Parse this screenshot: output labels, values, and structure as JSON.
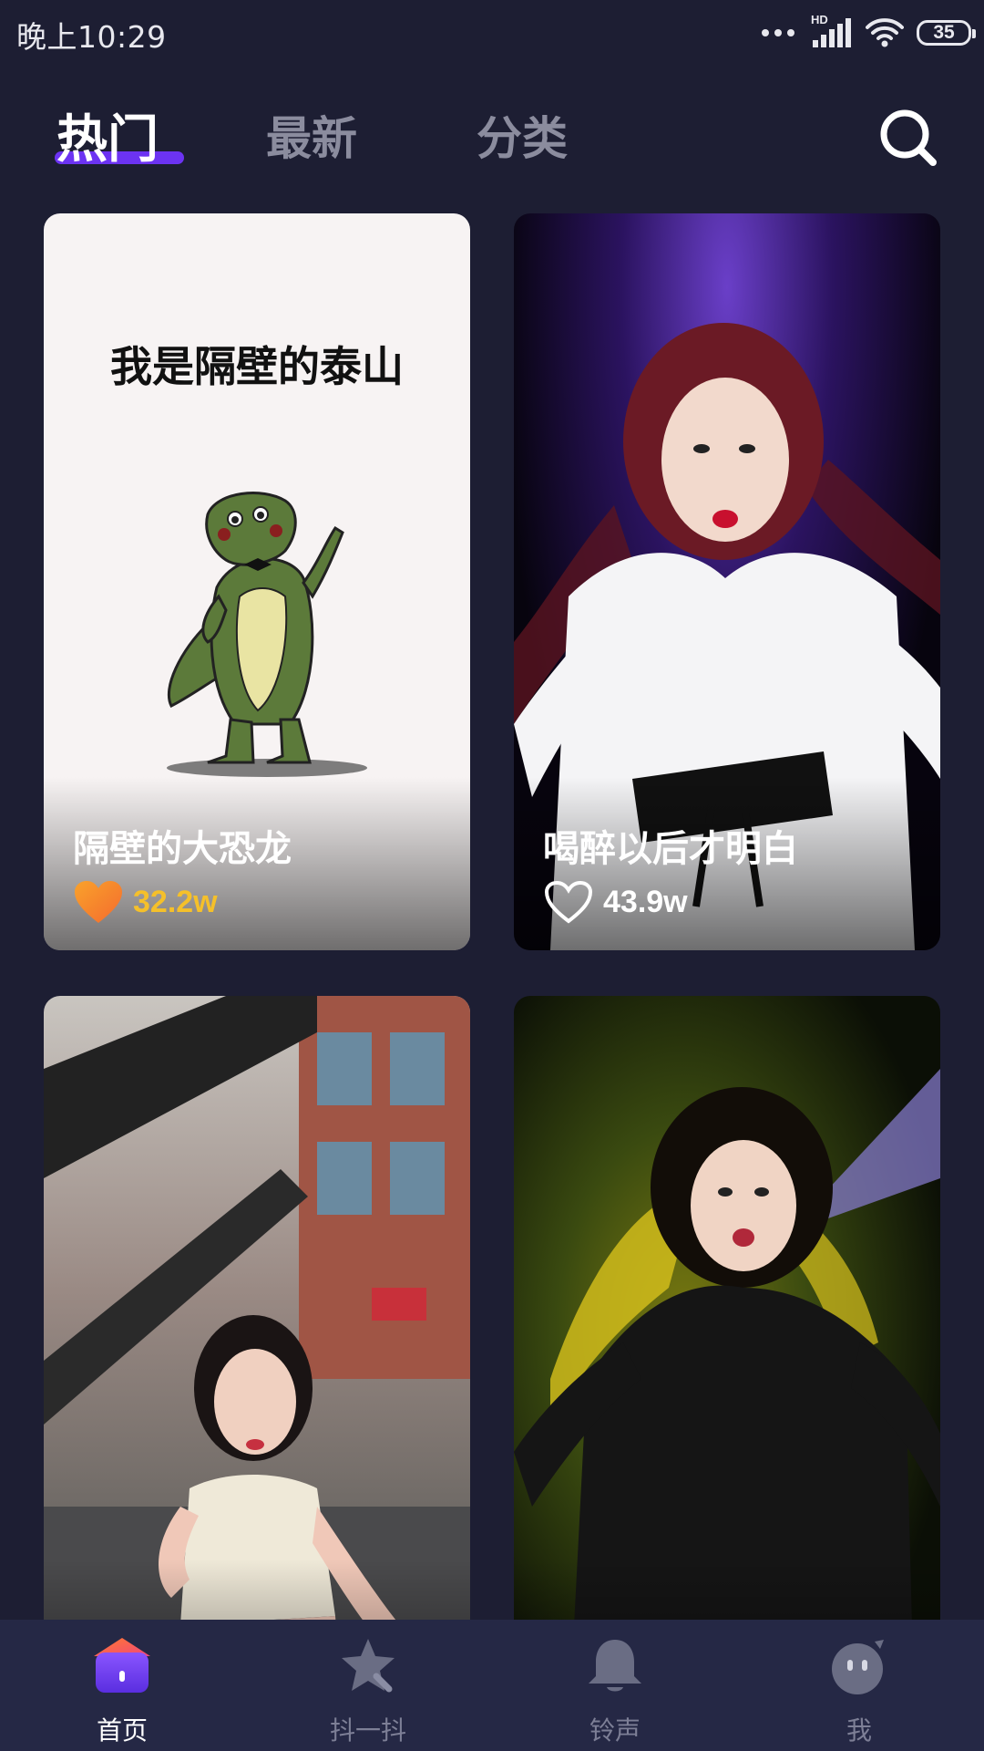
{
  "status_bar": {
    "time": "晚上10:29",
    "network_label": "HD",
    "battery": "35"
  },
  "tabs": [
    {
      "label": "热门",
      "active": true
    },
    {
      "label": "最新",
      "active": false
    },
    {
      "label": "分类",
      "active": false
    }
  ],
  "cards": [
    {
      "title": "隔壁的大恐龙",
      "likes": "32.2w",
      "liked": true,
      "image_text": "我是隔壁的泰山"
    },
    {
      "title": "喝醉以后才明白",
      "likes": "43.9w",
      "liked": false
    },
    {
      "title": "",
      "likes": "",
      "liked": false
    },
    {
      "title": "",
      "likes": "",
      "liked": false
    }
  ],
  "bottom_nav": [
    {
      "label": "首页",
      "icon": "home-icon",
      "active": true
    },
    {
      "label": "抖一抖",
      "icon": "shake-star-icon",
      "active": false
    },
    {
      "label": "铃声",
      "icon": "bell-icon",
      "active": false
    },
    {
      "label": "我",
      "icon": "profile-face-icon",
      "active": false
    }
  ],
  "colors": {
    "background": "#1d1e33",
    "accent": "#6c33f2",
    "likes_highlight": "#f5c02a",
    "nav_background": "#252845"
  }
}
